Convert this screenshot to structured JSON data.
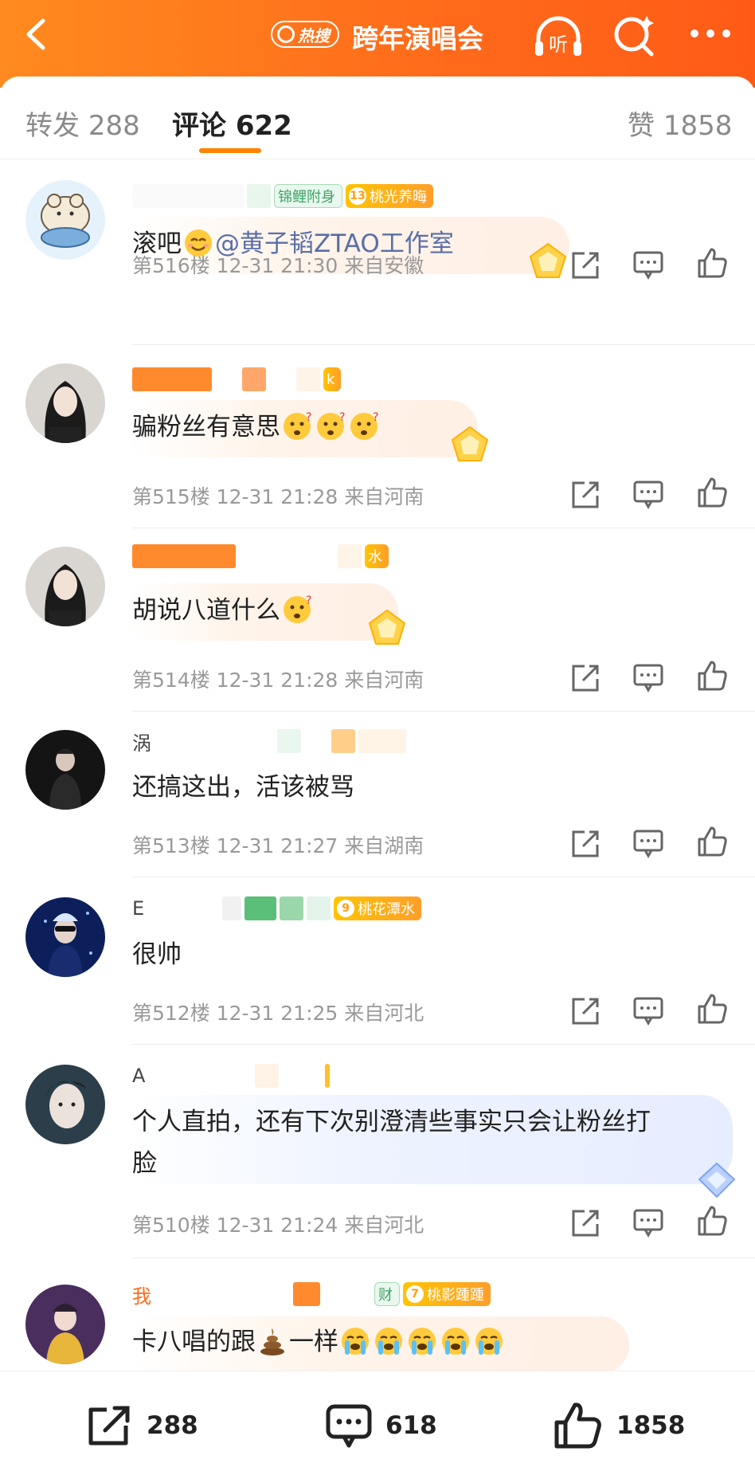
{
  "header": {
    "hot_label": "热搜",
    "title": "跨年演唱会",
    "listen_label": "听"
  },
  "tabs": [
    {
      "label": "转发",
      "count": "288"
    },
    {
      "label": "评论",
      "count": "622"
    },
    {
      "label": "赞",
      "count": "1858"
    }
  ],
  "comments": [
    {
      "badges": [
        {
          "text": "锦鲤附身",
          "style": "green"
        },
        {
          "level": "13",
          "text": "桃光养晦",
          "style": "gold"
        }
      ],
      "text": "滚吧",
      "mention": "@黄子韬ZTAO工作室",
      "floor": "第516楼",
      "time": "12-31 21:30",
      "location": "来自安徽"
    },
    {
      "text": "骗粉丝有意思",
      "badge_tail": "k",
      "floor": "第515楼",
      "time": "12-31 21:28",
      "location": "来自河南"
    },
    {
      "text": "胡说八道什么",
      "badge_tail": "水",
      "floor": "第514楼",
      "time": "12-31 21:28",
      "location": "来自河南"
    },
    {
      "name_char": "涡",
      "text": "还搞这出，活该被骂",
      "floor": "第513楼",
      "time": "12-31 21:27",
      "location": "来自湖南"
    },
    {
      "name_char": "E",
      "badges": [
        {
          "level": "9",
          "text": "桃花潭水",
          "style": "gold"
        }
      ],
      "text": "很帅",
      "floor": "第512楼",
      "time": "12-31 21:25",
      "location": "来自河北"
    },
    {
      "name_char": "A",
      "text_line1": "个人直拍，还有下次别澄清些事实只会让粉丝打",
      "text_line2": "脸",
      "floor": "第510楼",
      "time": "12-31 21:24",
      "location": "来自河北"
    },
    {
      "name_char": "我",
      "badges": [
        {
          "text": "财",
          "style": "green"
        },
        {
          "level": "7",
          "text": "桃影踵踵",
          "style": "gold"
        }
      ],
      "text_a": "卡八唱的跟",
      "text_b": "一样"
    }
  ],
  "bottom": {
    "repost": "288",
    "comment": "618",
    "like": "1858"
  },
  "colors": {
    "brand_orange": "#ff6a1a",
    "tab_accent": "#ff8200",
    "mention": "#5a6ea8"
  },
  "icons": [
    "back-icon",
    "search-icon",
    "headphones-icon",
    "more-icon",
    "repost-icon",
    "comment-icon",
    "like-icon"
  ]
}
